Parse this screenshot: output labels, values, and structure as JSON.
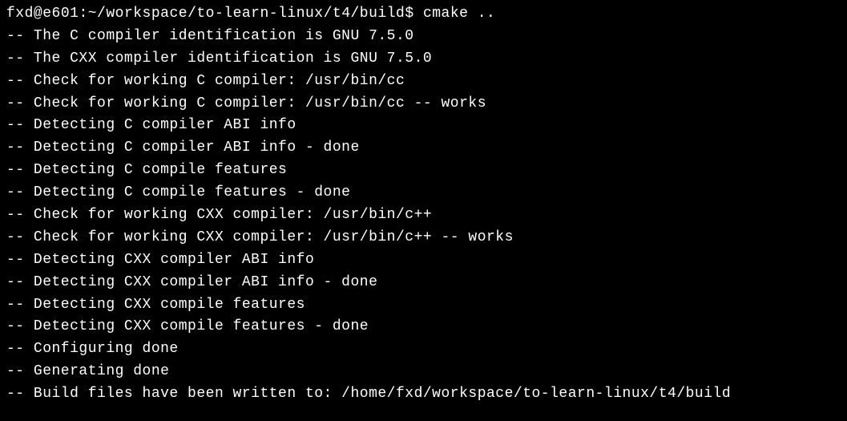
{
  "prompt": {
    "user": "fxd",
    "host": "e601",
    "path": "~/workspace/to-learn-linux/t4/build",
    "symbol": "$",
    "command": "cmake .."
  },
  "output_lines": [
    "-- The C compiler identification is GNU 7.5.0",
    "-- The CXX compiler identification is GNU 7.5.0",
    "-- Check for working C compiler: /usr/bin/cc",
    "-- Check for working C compiler: /usr/bin/cc -- works",
    "-- Detecting C compiler ABI info",
    "-- Detecting C compiler ABI info - done",
    "-- Detecting C compile features",
    "-- Detecting C compile features - done",
    "-- Check for working CXX compiler: /usr/bin/c++",
    "-- Check for working CXX compiler: /usr/bin/c++ -- works",
    "-- Detecting CXX compiler ABI info",
    "-- Detecting CXX compiler ABI info - done",
    "-- Detecting CXX compile features",
    "-- Detecting CXX compile features - done",
    "-- Configuring done",
    "-- Generating done",
    "-- Build files have been written to: /home/fxd/workspace/to-learn-linux/t4/build"
  ]
}
